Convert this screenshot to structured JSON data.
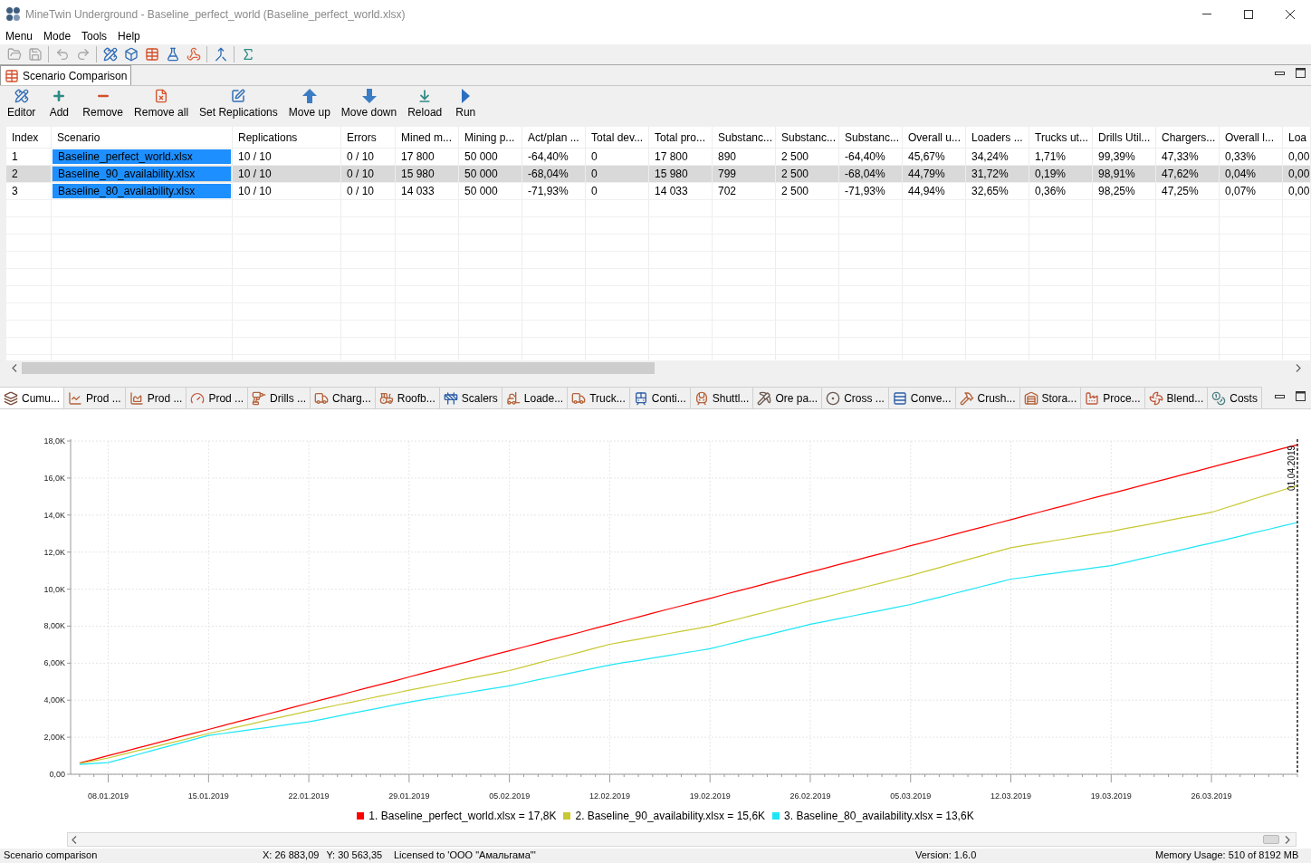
{
  "window": {
    "title": "MineTwin Underground - Baseline_perfect_world (Baseline_perfect_world.xlsx)"
  },
  "menu": [
    "Menu",
    "Mode",
    "Tools",
    "Help"
  ],
  "toolbar": {
    "groups": [
      [
        {
          "kind": "open",
          "disabled": true
        },
        {
          "kind": "save",
          "disabled": true
        }
      ],
      [
        {
          "kind": "undo",
          "disabled": true
        },
        {
          "kind": "redo",
          "disabled": true
        }
      ],
      [
        {
          "kind": "editor",
          "disabled": false
        },
        {
          "kind": "model",
          "disabled": false
        },
        {
          "kind": "table",
          "disabled": false
        },
        {
          "kind": "flask",
          "disabled": false
        },
        {
          "kind": "network",
          "disabled": false
        }
      ],
      [
        {
          "kind": "merge",
          "disabled": false
        }
      ],
      [
        {
          "kind": "sigma",
          "disabled": false
        }
      ]
    ]
  },
  "main_tabs": [
    {
      "label": "Scenario Comparison",
      "selected": true
    }
  ],
  "panel_toolbar": [
    "Editor",
    "Add",
    "Remove",
    "Remove all",
    "Set Replications",
    "Move up",
    "Move down",
    "Reload",
    "Run"
  ],
  "table": {
    "columns": [
      {
        "label": "Index",
        "highlighted": false
      },
      {
        "label": "Scenario",
        "highlighted": true
      },
      {
        "label": "Replications",
        "highlighted": false
      },
      {
        "label": "Errors",
        "highlighted": false
      },
      {
        "label": "Mined m...",
        "highlighted": false
      },
      {
        "label": "Mining p...",
        "highlighted": false
      },
      {
        "label": "Act/plan ...",
        "highlighted": false
      },
      {
        "label": "Total dev...",
        "highlighted": false
      },
      {
        "label": "Total pro...",
        "highlighted": false
      },
      {
        "label": "Substanc...",
        "highlighted": false
      },
      {
        "label": "Substanc...",
        "highlighted": false
      },
      {
        "label": "Substanc...",
        "highlighted": false
      },
      {
        "label": "Overall u...",
        "highlighted": false
      },
      {
        "label": "Loaders ...",
        "highlighted": false
      },
      {
        "label": "Trucks ut...",
        "highlighted": false
      },
      {
        "label": "Drills Util...",
        "highlighted": false
      },
      {
        "label": "Chargers...",
        "highlighted": false
      },
      {
        "label": "Overall l...",
        "highlighted": false
      },
      {
        "label": "Loa",
        "highlighted": false
      }
    ],
    "rows": [
      {
        "selected": false,
        "cells": [
          "1",
          "Baseline_perfect_world.xlsx",
          "10 / 10",
          "0 / 10",
          "17 800",
          "50 000",
          "-64,40%",
          "0",
          "17 800",
          "890",
          "2 500",
          "-64,40%",
          "45,67%",
          "34,24%",
          "1,71%",
          "99,39%",
          "47,33%",
          "0,33%",
          "0,00"
        ]
      },
      {
        "selected": true,
        "cells": [
          "2",
          "Baseline_90_availability.xlsx",
          "10 / 10",
          "0 / 10",
          "15 980",
          "50 000",
          "-68,04%",
          "0",
          "15 980",
          "799",
          "2 500",
          "-68,04%",
          "44,79%",
          "31,72%",
          "0,19%",
          "98,91%",
          "47,62%",
          "0,04%",
          "0,00"
        ]
      },
      {
        "selected": false,
        "cells": [
          "3",
          "Baseline_80_availability.xlsx",
          "10 / 10",
          "0 / 10",
          "14 033",
          "50 000",
          "-71,93%",
          "0",
          "14 033",
          "702",
          "2 500",
          "-71,93%",
          "44,94%",
          "32,65%",
          "0,36%",
          "98,25%",
          "47,25%",
          "0,07%",
          "0,00"
        ]
      }
    ]
  },
  "chart_tabs": [
    {
      "label": "Cumu...",
      "selected": true
    },
    {
      "label": "Prod ...",
      "selected": false
    },
    {
      "label": "Prod ...",
      "selected": false
    },
    {
      "label": "Prod ...",
      "selected": false
    },
    {
      "label": "Drills ...",
      "selected": false
    },
    {
      "label": "Charg...",
      "selected": false
    },
    {
      "label": "Roofb...",
      "selected": false
    },
    {
      "label": "Scalers",
      "selected": false
    },
    {
      "label": "Loade...",
      "selected": false
    },
    {
      "label": "Truck...",
      "selected": false
    },
    {
      "label": "Conti...",
      "selected": false
    },
    {
      "label": "Shuttl...",
      "selected": false
    },
    {
      "label": "Ore pa...",
      "selected": false
    },
    {
      "label": "Cross ...",
      "selected": false
    },
    {
      "label": "Conve...",
      "selected": false
    },
    {
      "label": "Crush...",
      "selected": false
    },
    {
      "label": "Stora...",
      "selected": false
    },
    {
      "label": "Proce...",
      "selected": false
    },
    {
      "label": "Blend...",
      "selected": false
    },
    {
      "label": "Costs",
      "selected": false
    }
  ],
  "chart": {
    "chart_data": {
      "type": "line",
      "categories": [
        null,
        null,
        "08.01.2019",
        null,
        null,
        null,
        null,
        null,
        null,
        "15.01.2019",
        null,
        null,
        null,
        null,
        null,
        null,
        "22.01.2019",
        null,
        null,
        null,
        null,
        null,
        null,
        "29.01.2019",
        null,
        null,
        null,
        null,
        null,
        null,
        "05.02.2019",
        null,
        null,
        null,
        null,
        null,
        null,
        "12.02.2019",
        null,
        null,
        null,
        null,
        null,
        null,
        "19.02.2019",
        null,
        null,
        null,
        null,
        null,
        null,
        "26.02.2019",
        null,
        null,
        null,
        null,
        null,
        null,
        "05.03.2019",
        null,
        null,
        null,
        null,
        null,
        null,
        "12.03.2019",
        null,
        null,
        null,
        null,
        null,
        null,
        "19.03.2019",
        null,
        null,
        null,
        null,
        null,
        null,
        "26.03.2019",
        null,
        null,
        null,
        null,
        null,
        null
      ],
      "series": [
        {
          "name": "1. Baseline_perfect_world.xlsx = 17,8K",
          "color": "#ff0000",
          "values": [
            600,
            800,
            1010,
            1210,
            1410,
            1610,
            1820,
            2020,
            2220,
            2420,
            2620,
            2830,
            3030,
            3230,
            3430,
            3640,
            3840,
            4040,
            4240,
            4450,
            4650,
            4850,
            5050,
            5260,
            5460,
            5660,
            5860,
            6060,
            6270,
            6470,
            6670,
            6870,
            7080,
            7280,
            7480,
            7680,
            7890,
            8090,
            8290,
            8490,
            8700,
            8900,
            9100,
            9300,
            9500,
            9710,
            9910,
            10110,
            10310,
            10520,
            10720,
            10920,
            11120,
            11330,
            11530,
            11730,
            11930,
            12130,
            12340,
            12540,
            12740,
            12940,
            13150,
            13350,
            13550,
            13750,
            13960,
            14160,
            14360,
            14560,
            14770,
            14970,
            15170,
            15370,
            15570,
            15780,
            15980,
            16180,
            16380,
            16590,
            16790,
            16990,
            17190,
            17400,
            17600,
            17800
          ]
        },
        {
          "name": "2. Baseline_90_availability.xlsx = 15,6K",
          "color": "#c8c832",
          "values": [
            580,
            730,
            880,
            1070,
            1260,
            1440,
            1630,
            1820,
            2010,
            2200,
            2370,
            2550,
            2720,
            2900,
            3070,
            3250,
            3420,
            3580,
            3740,
            3900,
            4060,
            4220,
            4380,
            4540,
            4690,
            4840,
            4990,
            5150,
            5300,
            5450,
            5600,
            5800,
            6010,
            6210,
            6410,
            6610,
            6820,
            7020,
            7160,
            7300,
            7440,
            7580,
            7720,
            7860,
            8000,
            8200,
            8390,
            8590,
            8780,
            8980,
            9170,
            9370,
            9560,
            9760,
            9950,
            10150,
            10340,
            10540,
            10730,
            10950,
            11160,
            11380,
            11600,
            11810,
            12030,
            12240,
            12370,
            12490,
            12620,
            12740,
            12870,
            12990,
            13120,
            13270,
            13410,
            13560,
            13710,
            13860,
            14000,
            14150,
            14390,
            14630,
            14880,
            15120,
            15360,
            15600
          ]
        },
        {
          "name": "3. Baseline_80_availability.xlsx = 13,6K",
          "color": "#1ee6f5",
          "values": [
            530,
            580,
            630,
            840,
            1050,
            1260,
            1470,
            1680,
            1890,
            2100,
            2200,
            2310,
            2410,
            2510,
            2620,
            2730,
            2830,
            2980,
            3140,
            3290,
            3440,
            3590,
            3750,
            3900,
            4030,
            4150,
            4280,
            4400,
            4530,
            4650,
            4780,
            4940,
            5100,
            5260,
            5420,
            5580,
            5740,
            5900,
            6030,
            6150,
            6280,
            6400,
            6530,
            6650,
            6780,
            6970,
            7160,
            7350,
            7530,
            7720,
            7910,
            8100,
            8250,
            8410,
            8560,
            8710,
            8860,
            9020,
            9170,
            9370,
            9560,
            9760,
            9950,
            10150,
            10340,
            10540,
            10640,
            10750,
            10850,
            10960,
            11060,
            11170,
            11270,
            11440,
            11620,
            11790,
            11970,
            12140,
            12320,
            12490,
            12680,
            12860,
            13050,
            13230,
            13420,
            13600
          ]
        }
      ],
      "ylim": [
        0,
        18000
      ],
      "yticks": [
        {
          "value": 0,
          "label": "0,00"
        },
        {
          "value": 2000,
          "label": "2,00K"
        },
        {
          "value": 4000,
          "label": "4,00K"
        },
        {
          "value": 6000,
          "label": "6,00K"
        },
        {
          "value": 8000,
          "label": "8,00K"
        },
        {
          "value": 10000,
          "label": "10,0K"
        },
        {
          "value": 12000,
          "label": "12,0K"
        },
        {
          "value": 14000,
          "label": "14,0K"
        },
        {
          "value": 16000,
          "label": "16,0K"
        },
        {
          "value": 18000,
          "label": "18,0K"
        }
      ],
      "grid": true,
      "legend": "bottom"
    },
    "date_marker": "01.04.2019"
  },
  "status_bar": {
    "mode": "Scenario comparison",
    "cursor_x": "X: 26 883,09",
    "cursor_y": "Y: 30 563,35",
    "license": "Licensed to 'ООО \"Амальгама\"'",
    "version": "Version: 1.6.0",
    "memory": "Memory Usage: 510 of 8192 MB"
  }
}
